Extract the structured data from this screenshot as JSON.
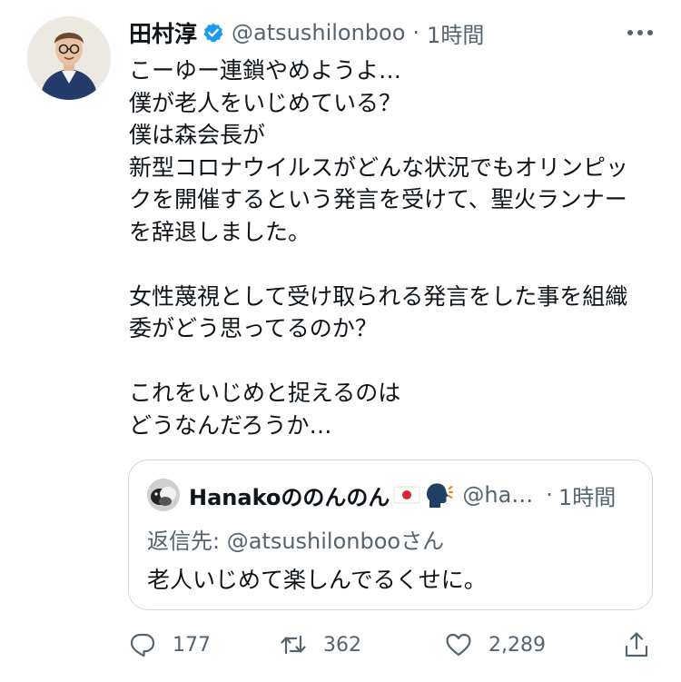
{
  "author": {
    "display_name": "田村淳",
    "handle": "@atsushilonboo",
    "separator": "·",
    "time": "1時間",
    "avatar_icon": "profile-photo-avatar",
    "verified_icon": "verified-badge-icon"
  },
  "tweet": {
    "lines": [
      "こーゆー連鎖やめようよ…",
      "僕が老人をいじめている？",
      "僕は森会長が",
      "新型コロナウイルスがどんな状況でもオリンピッ",
      "クを開催するという発言を受けて、聖火ランナー",
      "を辞退しました。",
      "",
      "女性蔑視として受け取られる発言をした事を組織",
      "委がどう思ってるのか？",
      "",
      "これをいじめと捉えるのは",
      "どうなんだろうか…"
    ]
  },
  "quote": {
    "display_name": "Hanakoののんのん",
    "emoji_icons": [
      "japan-flag-icon",
      "speaking-head-icon"
    ],
    "handle": "@ha…",
    "separator": "·",
    "time": "1時間",
    "reply_prefix": "返信先: ",
    "reply_mention": "@atsushilonboo",
    "reply_suffix": "さん",
    "text": "老人いじめて楽しんでるくせに。"
  },
  "actions": {
    "reply_count": "177",
    "retweet_count": "362",
    "like_count": "2,289"
  },
  "colors": {
    "text_primary": "#0f1419",
    "text_secondary": "#536471",
    "verified_blue": "#1d9bf0",
    "border": "#cfd9de"
  }
}
